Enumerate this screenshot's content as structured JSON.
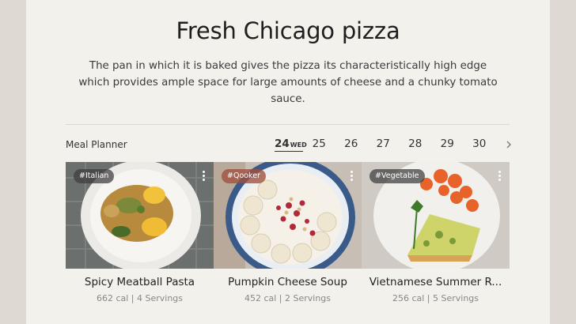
{
  "header": {
    "title": "Fresh Chicago pizza",
    "subtitle": "The pan in which it is baked gives the pizza its characteristically high edge which provides ample space for large amounts of cheese and a chunky tomato sauce."
  },
  "planner": {
    "label": "Meal Planner",
    "active_date": {
      "num": "24",
      "day": "WED"
    },
    "dates": [
      "25",
      "26",
      "27",
      "28",
      "29",
      "30"
    ]
  },
  "cards": [
    {
      "tag": "#Italian",
      "title": "Spicy Meatball Pasta",
      "meta": "662 cal | 4 Servings"
    },
    {
      "tag": "#Qooker",
      "title": "Pumpkin Cheese Soup",
      "meta": "452 cal | 2 Servings"
    },
    {
      "tag": "#Vegetable",
      "title": "Vietnamese Summer R...",
      "meta": "256 cal | 5 Servings"
    }
  ],
  "icons": {
    "next": "chevron-right-icon",
    "more": "more-vertical-icon"
  },
  "colors": {
    "panel": "#f3f1ec",
    "background": "#dedad3",
    "qooker_tag": "#a0503c"
  }
}
